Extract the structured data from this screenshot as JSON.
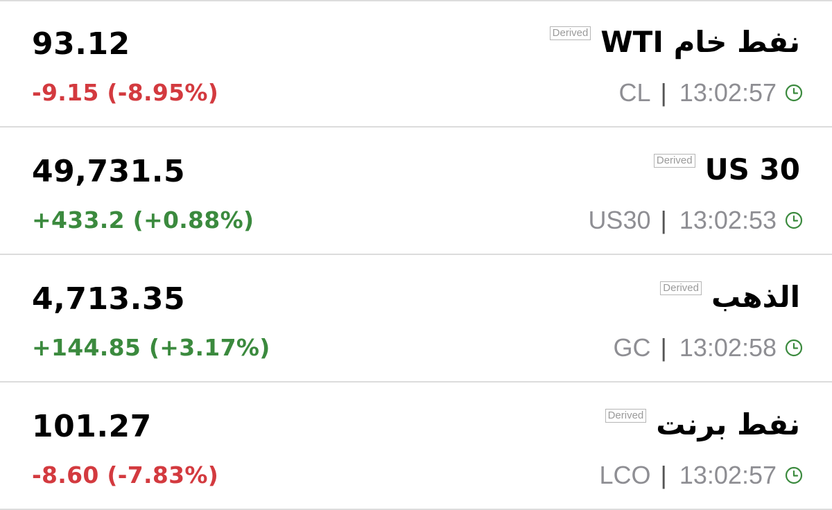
{
  "quotes": [
    {
      "name": "US 30",
      "badge": "Derived",
      "price": "49,731.5",
      "change": "+433.2 (+0.88%)",
      "direction": "up",
      "symbol": "US30",
      "separator": "|",
      "time": "13:02:53"
    },
    {
      "name": "الذهب",
      "badge": "Derived",
      "price": "4,713.35",
      "change": "+144.85 (+3.17%)",
      "direction": "up",
      "symbol": "GC",
      "separator": "|",
      "time": "13:02:58"
    },
    {
      "name": "نفط برنت",
      "badge": "Derived",
      "price": "101.27",
      "change": "-8.60 (-7.83%)",
      "direction": "down",
      "symbol": "LCO",
      "separator": "|",
      "time": "13:02:57"
    },
    {
      "name": "نفط خام WTI",
      "badge": "Derived",
      "price": "93.12",
      "change": "-9.15 (-8.95%)",
      "direction": "down",
      "symbol": "CL",
      "separator": "|",
      "time": "13:02:57"
    }
  ],
  "colors": {
    "up": "#3b8a3e",
    "down": "#d33a3f",
    "clock": "#3b8a3e",
    "meta": "#8e8e93"
  },
  "icons": {
    "clock": "clock-icon"
  }
}
